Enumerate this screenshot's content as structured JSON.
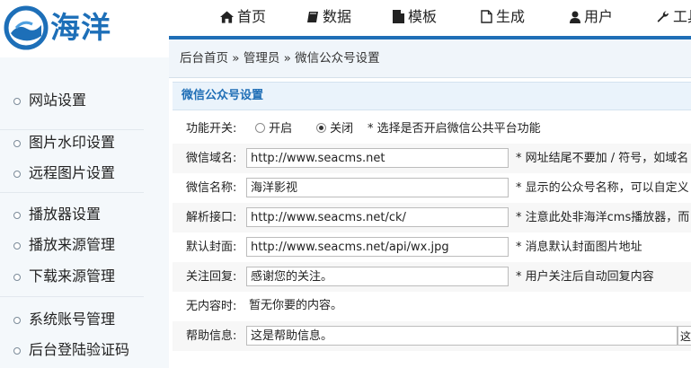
{
  "logo": {
    "text": "海洋"
  },
  "nav": [
    {
      "label": "首页",
      "icon": "home-icon"
    },
    {
      "label": "数据",
      "icon": "book-icon"
    },
    {
      "label": "模板",
      "icon": "file-icon"
    },
    {
      "label": "生成",
      "icon": "document-outline-icon"
    },
    {
      "label": "用户",
      "icon": "user-icon"
    },
    {
      "label": "工具",
      "icon": "wrench-icon"
    }
  ],
  "breadcrumb": "后台首页 » 管理员 » 微信公众号设置",
  "sidebar": {
    "items": [
      "网站设置",
      "图片水印设置",
      "远程图片设置",
      "播放器设置",
      "播放来源管理",
      "下载来源管理",
      "系统账号管理",
      "后台登陆验证码"
    ]
  },
  "section_title": "微信公众号设置",
  "form": {
    "switch": {
      "label": "功能开关:",
      "option_on": "开启",
      "option_off": "关闭",
      "selected": "关闭",
      "note": "* 选择是否开启微信公共平台功能"
    },
    "domain": {
      "label": "微信域名:",
      "value": "http://www.seacms.net",
      "note": "* 网址结尾不要加 / 符号，如域名"
    },
    "name": {
      "label": "微信名称:",
      "value": "海洋影视",
      "note": "* 显示的公众号名称，可以自定义"
    },
    "api": {
      "label": "解析接口:",
      "value": "http://www.seacms.net/ck/",
      "note": "* 注意此处非海洋cms播放器，而"
    },
    "cover": {
      "label": "默认封面:",
      "value": "http://www.seacms.net/api/wx.jpg",
      "note": "* 消息默认封面图片地址"
    },
    "follow_reply": {
      "label": "关注回复:",
      "value": "感谢您的关注。",
      "note": "* 用户关注后自动回复内容"
    },
    "no_content": {
      "label": "无内容时:",
      "value": "暂无你要的内容。"
    },
    "help": {
      "label": "帮助信息:",
      "value": "这是帮助信息。",
      "stub": "这"
    }
  },
  "colors": {
    "accent": "#1f6eb6",
    "sidebar_bg": "#f4f8fb",
    "crumb_bg": "#f0f5fa",
    "section_bg": "#eaf3fb"
  }
}
